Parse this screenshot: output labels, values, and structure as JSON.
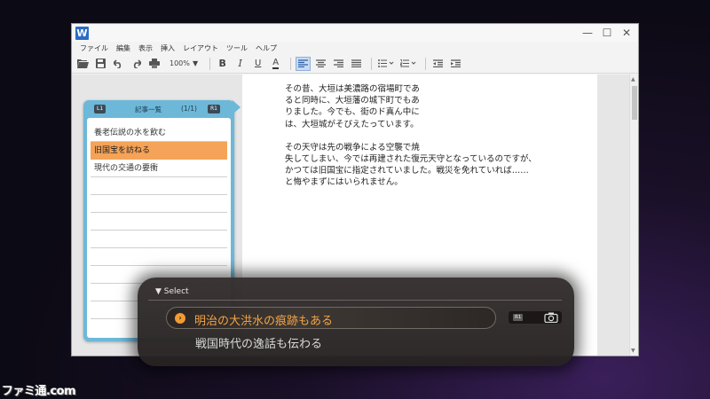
{
  "window": {
    "app_icon_letter": "W",
    "controls": {
      "minimize": "—",
      "maximize": "☐",
      "close": "✕"
    }
  },
  "menu": [
    "ファイル",
    "編集",
    "表示",
    "挿入",
    "レイアウト",
    "ツール",
    "ヘルプ"
  ],
  "toolbar": {
    "zoom": "100%",
    "bold": "B",
    "italic": "I",
    "underline": "U",
    "font_color": "A"
  },
  "document": {
    "paragraph1": [
      "その昔、大垣は美濃路の宿場町であ",
      "ると同時に、大垣藩の城下町でもあ",
      "りました。今でも、街のド真ん中に",
      "は、大垣城がそびえたっています。"
    ],
    "paragraph2": [
      "その天守は先の戦争による空襲で焼",
      "失してしまい、今では再建された復元天守となっているのですが、",
      "かつては旧国宝に指定されていました。戦災を免れていれば……",
      "と悔やまずにはいられません。"
    ]
  },
  "article_panel": {
    "left_button": "L1",
    "title": "記事一覧",
    "count": "(1/1)",
    "right_button": "R1",
    "items": [
      "養老伝説の水を飲む",
      "旧国宝を訪ねる",
      "現代の交通の要衝"
    ],
    "selected_index": 1
  },
  "select": {
    "title": "▼ Select",
    "options": [
      "明治の大洪水の痕跡もある",
      "戦国時代の逸話も伝わる"
    ],
    "selected_index": 0,
    "camera_button": "R1"
  },
  "logo": "ファミ通.com",
  "colors": {
    "panel_blue": "#6db8d8",
    "selected_orange": "#f5a358",
    "select_accent": "#f5a345",
    "active_align": "#c9daf0"
  }
}
